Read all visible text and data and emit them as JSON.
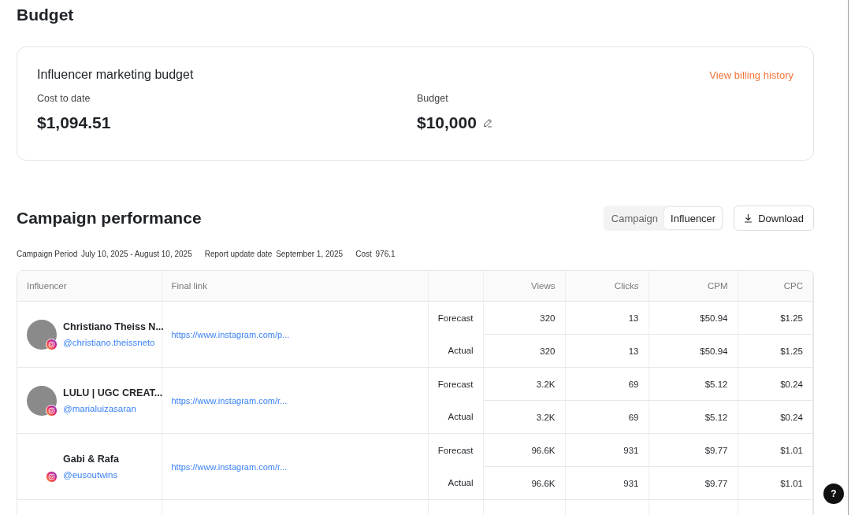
{
  "budget": {
    "title": "Budget",
    "card_title": "Influencer marketing budget",
    "billing_link": "View billing history",
    "cost_label": "Cost to date",
    "cost_value": "$1,094.51",
    "budget_label": "Budget",
    "budget_value": "$10,000"
  },
  "performance": {
    "title": "Campaign performance",
    "view_toggle": [
      {
        "label": "Campaign",
        "selected": false
      },
      {
        "label": "Influencer",
        "selected": true
      }
    ],
    "download": "Download",
    "meta": [
      {
        "label": "Campaign Period",
        "value": "July 10, 2025 - August 10, 2025"
      },
      {
        "label": "Report update date",
        "value": "September 1, 2025"
      },
      {
        "label": "Cost",
        "value": "976.1"
      }
    ],
    "columns": [
      "Influencer",
      "Final link",
      "Views",
      "Clicks",
      "CPM",
      "CPC"
    ],
    "rows": [
      {
        "name": "Christiano Theiss N...",
        "handle": "@christiano.theissneto",
        "link": "https://www.instagram.com/p...",
        "has_avatar": true,
        "metrics": [
          {
            "label": "Forecast",
            "values": [
              "320",
              "13",
              "$50.94",
              "$1.25"
            ]
          },
          {
            "label": "Actual",
            "values": [
              "320",
              "13",
              "$50.94",
              "$1.25"
            ]
          }
        ]
      },
      {
        "name": "LULU | UGC CREAT...",
        "handle": "@marialuizasaran",
        "link": "https://www.instagram.com/r...",
        "has_avatar": true,
        "metrics": [
          {
            "label": "Forecast",
            "values": [
              "3.2K",
              "69",
              "$5.12",
              "$0.24"
            ]
          },
          {
            "label": "Actual",
            "values": [
              "3.2K",
              "69",
              "$5.12",
              "$0.24"
            ]
          }
        ]
      },
      {
        "name": "Gabi & Rafa",
        "handle": "@eusoutwins",
        "link": "https://www.instagram.com/r...",
        "has_avatar": false,
        "metrics": [
          {
            "label": "Forecast",
            "values": [
              "96.6K",
              "931",
              "$9.77",
              "$1.01"
            ]
          },
          {
            "label": "Actual",
            "values": [
              "96.6K",
              "931",
              "$9.77",
              "$1.01"
            ]
          }
        ]
      }
    ]
  },
  "help_button": "?"
}
